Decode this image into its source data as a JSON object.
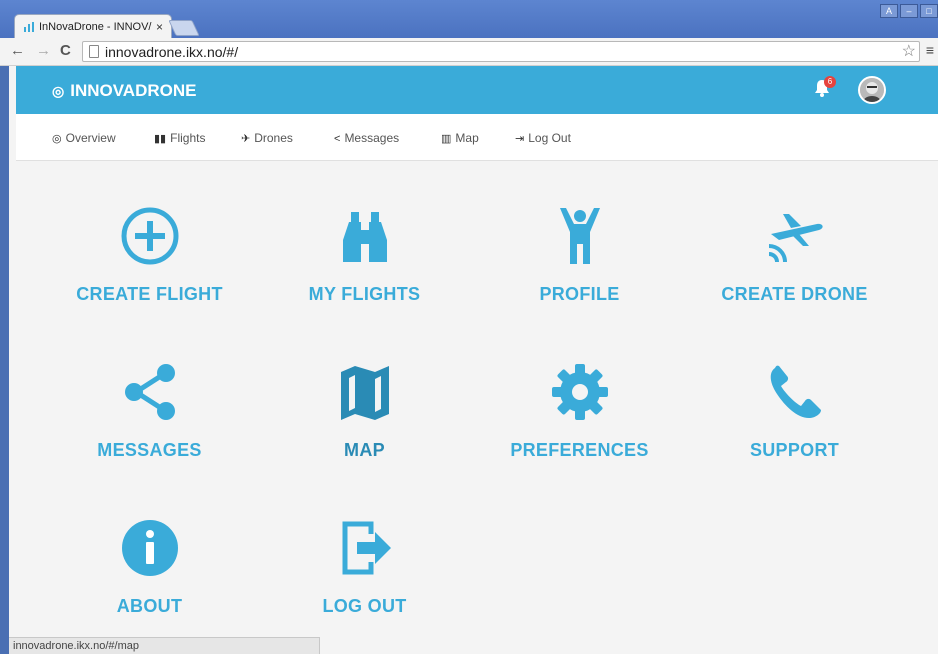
{
  "browser": {
    "tab_title": "InNovaDrone - INNOV/",
    "tab_close": "×",
    "url": "innovadrone.ikx.no/#/",
    "back": "←",
    "forward": "→",
    "reload": "C",
    "star": "☆",
    "menu": "≡",
    "window_buttons": [
      "A",
      "–",
      "□"
    ]
  },
  "app": {
    "brand": "INNOVADRONE",
    "notification_count": "6",
    "accent_color": "#3aabd9"
  },
  "subnav": {
    "items": [
      {
        "label": "Overview",
        "icon": "target-icon"
      },
      {
        "label": "Flights",
        "icon": "binoculars-icon"
      },
      {
        "label": "Drones",
        "icon": "plane-icon"
      },
      {
        "label": "Messages",
        "icon": "share-icon"
      },
      {
        "label": "Map",
        "icon": "map-icon"
      },
      {
        "label": "Log Out",
        "icon": "logout-icon"
      }
    ]
  },
  "tiles": [
    {
      "label": "CREATE FLIGHT",
      "icon": "plus-circle-icon"
    },
    {
      "label": "MY FLIGHTS",
      "icon": "binoculars-icon"
    },
    {
      "label": "PROFILE",
      "icon": "person-icon"
    },
    {
      "label": "CREATE DRONE",
      "icon": "plane-icon"
    },
    {
      "label": "MESSAGES",
      "icon": "share-icon"
    },
    {
      "label": "MAP",
      "icon": "map-icon"
    },
    {
      "label": "PREFERENCES",
      "icon": "gear-icon"
    },
    {
      "label": "SUPPORT",
      "icon": "phone-icon"
    },
    {
      "label": "ABOUT",
      "icon": "info-icon"
    },
    {
      "label": "LOG OUT",
      "icon": "logout-icon"
    }
  ],
  "status_bar": "innovadrone.ikx.no/#/map"
}
